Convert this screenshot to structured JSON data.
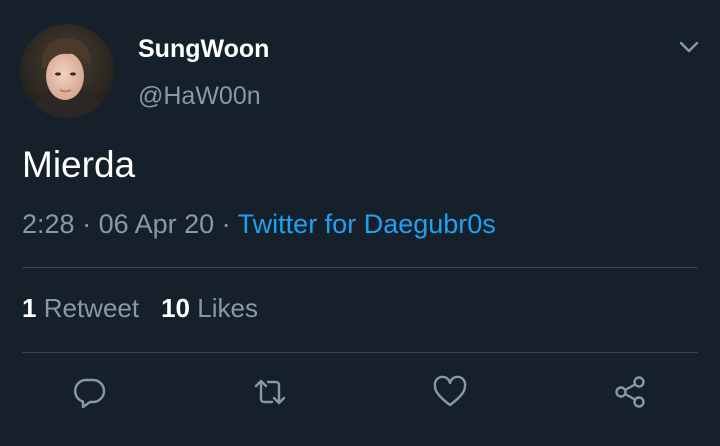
{
  "user": {
    "display_name": "SungWoon",
    "handle": "@HaW00n"
  },
  "tweet": {
    "text": "Mierda",
    "time": "2:28",
    "date": "06 Apr 20",
    "separator": " · ",
    "source": "Twitter for Daegubr0s"
  },
  "stats": {
    "retweet_count": "1",
    "retweet_label": "Retweet",
    "like_count": "10",
    "like_label": "Likes"
  },
  "icons": {
    "caret": "chevron-down-icon",
    "reply": "reply-icon",
    "retweet": "retweet-icon",
    "like": "heart-icon",
    "share": "share-icon"
  },
  "colors": {
    "background": "#15202b",
    "primary_text": "#ffffff",
    "secondary_text": "#8899a6",
    "link": "#1da1f2",
    "divider": "#38444d"
  }
}
